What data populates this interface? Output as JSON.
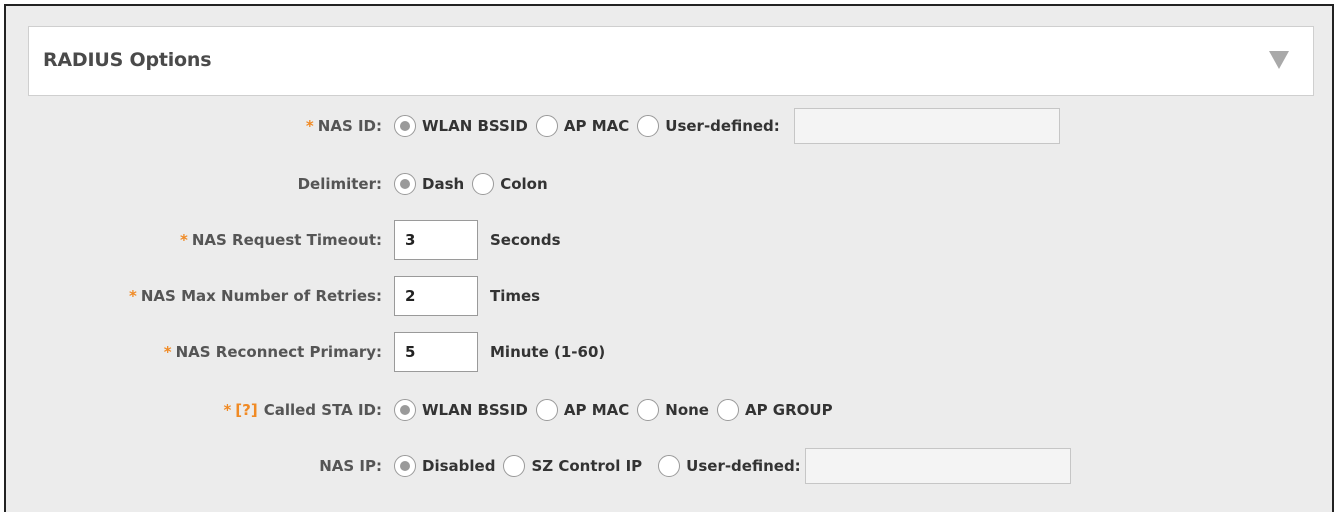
{
  "panel": {
    "title": "RADIUS Options",
    "collapse_icon": "triangle-down-icon"
  },
  "nas_id": {
    "required": "*",
    "label": "NAS ID:",
    "options": [
      "WLAN BSSID",
      "AP MAC",
      "User-defined:"
    ],
    "selected": "WLAN BSSID",
    "custom_value": ""
  },
  "delimiter": {
    "label": "Delimiter:",
    "options": [
      "Dash",
      "Colon"
    ],
    "selected": "Dash"
  },
  "nas_request_timeout": {
    "required": "*",
    "label": "NAS Request Timeout:",
    "value": "3",
    "unit": "Seconds"
  },
  "nas_max_retries": {
    "required": "*",
    "label": "NAS Max Number of Retries:",
    "value": "2",
    "unit": "Times"
  },
  "nas_reconnect_primary": {
    "required": "*",
    "label": "NAS Reconnect Primary:",
    "value": "5",
    "unit": "Minute (1-60)"
  },
  "called_sta_id": {
    "required": "*",
    "help": "[?]",
    "label": "Called STA ID:",
    "options": [
      "WLAN BSSID",
      "AP MAC",
      "None",
      "AP GROUP"
    ],
    "selected": "WLAN BSSID"
  },
  "nas_ip": {
    "label": "NAS IP:",
    "options": [
      "Disabled",
      "SZ Control IP",
      "User-defined:"
    ],
    "selected": "Disabled",
    "custom_value": ""
  },
  "colors": {
    "required": "#f08a24",
    "background": "#ececec"
  }
}
